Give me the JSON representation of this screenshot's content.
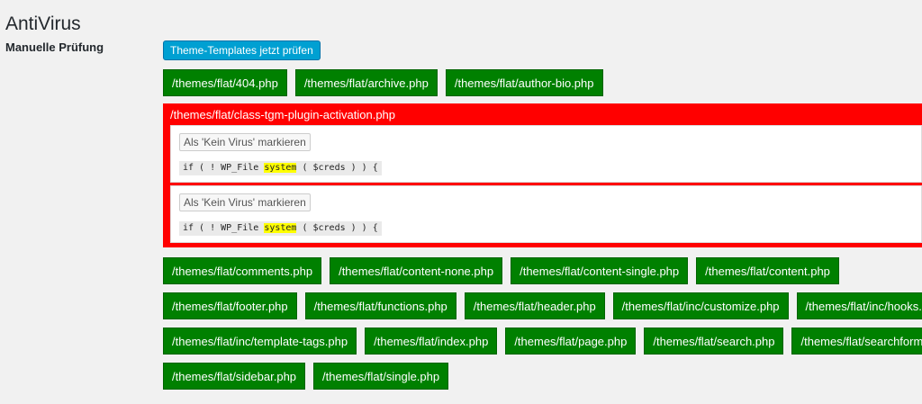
{
  "page": {
    "title": "AntiVirus"
  },
  "section": {
    "label": "Manuelle Prüfung",
    "check_button": "Theme-Templates jetzt prüfen"
  },
  "files_before": [
    "/themes/flat/404.php",
    "/themes/flat/archive.php",
    "/themes/flat/author-bio.php"
  ],
  "infected": {
    "file": "/themes/flat/class-tgm-plugin-activation.php",
    "findings": [
      {
        "mark_label": "Als 'Kein Virus' markieren",
        "code_before": "if ( ! WP_File",
        "code_match": "system",
        "code_after": "( $creds ) ) {"
      },
      {
        "mark_label": "Als 'Kein Virus' markieren",
        "code_before": "if ( ! WP_File",
        "code_match": "system",
        "code_after": "( $creds ) ) {"
      }
    ]
  },
  "files_after": [
    [
      "/themes/flat/comments.php",
      "/themes/flat/content-none.php",
      "/themes/flat/content-single.php",
      "/themes/flat/content.php"
    ],
    [
      "/themes/flat/footer.php",
      "/themes/flat/functions.php",
      "/themes/flat/header.php",
      "/themes/flat/inc/customize.php",
      "/themes/flat/inc/hooks.php"
    ],
    [
      "/themes/flat/inc/template-tags.php",
      "/themes/flat/index.php",
      "/themes/flat/page.php",
      "/themes/flat/search.php",
      "/themes/flat/searchform.php"
    ],
    [
      "/themes/flat/sidebar.php",
      "/themes/flat/single.php"
    ]
  ],
  "colors": {
    "clean": "#008000",
    "infected": "#ff0000",
    "primary_button": "#00a0d2",
    "highlight": "#ffff00"
  }
}
